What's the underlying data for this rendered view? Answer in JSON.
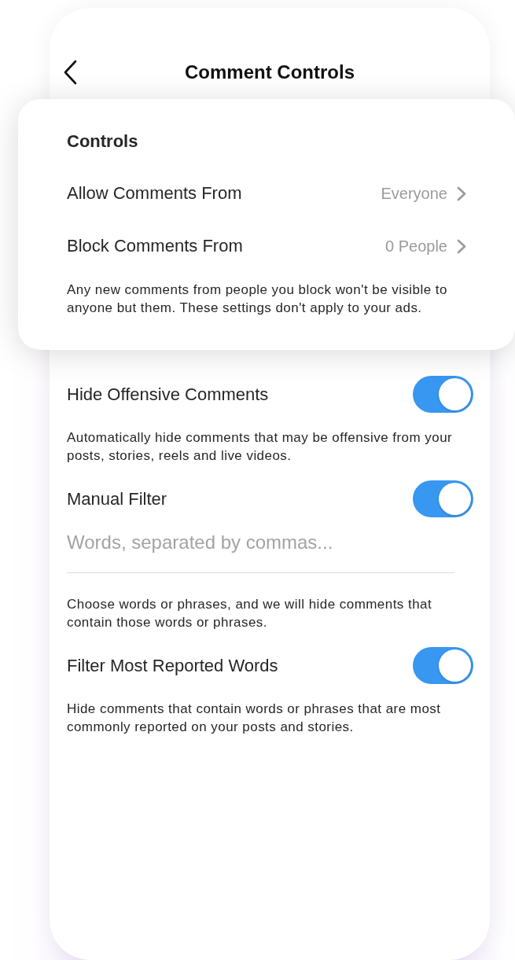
{
  "header": {
    "title": "Comment Controls"
  },
  "controls": {
    "heading": "Controls",
    "rows": [
      {
        "label": "Allow Comments From",
        "value": "Everyone"
      },
      {
        "label": "Block Comments From",
        "value": "0 People"
      }
    ],
    "note": "Any new comments from people you block won't be visible to anyone but them. These settings don't apply to your ads."
  },
  "settings": [
    {
      "kind": "toggle",
      "label": "Hide Offensive Comments",
      "on": true,
      "description": "Automatically hide comments that may be offensive from your posts, stories, reels and live videos."
    },
    {
      "kind": "toggle",
      "label": "Manual Filter",
      "on": true,
      "placeholder": "Words, separated by commas...",
      "description": "Choose words or phrases, and we will hide comments that contain those words or phrases."
    },
    {
      "kind": "toggle",
      "label": "Filter Most Reported Words",
      "on": true,
      "description": "Hide comments that contain words or phrases that are most commonly reported on your posts and stories."
    }
  ]
}
